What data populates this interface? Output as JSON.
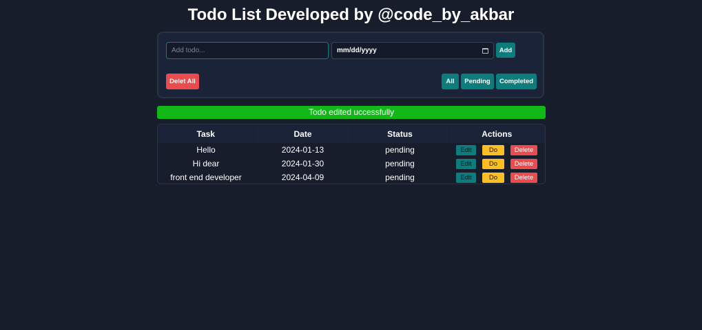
{
  "header": {
    "title": "Todo List Developed by @code_by_akbar"
  },
  "form": {
    "todo_placeholder": "Add todo...",
    "todo_value": "",
    "date_value": "mm/dd/yyyy",
    "date_icon": "calendar-icon",
    "add_label": "Add"
  },
  "controls": {
    "delete_all_label": "Delet All",
    "filters": [
      {
        "label": "All"
      },
      {
        "label": "Pending"
      },
      {
        "label": "Completed"
      }
    ]
  },
  "alert": {
    "text": "Todo edited uccessfully",
    "color": "#12b718"
  },
  "table": {
    "headers": [
      "Task",
      "Date",
      "Status",
      "Actions"
    ],
    "rows": [
      {
        "task": "Hello",
        "date": "2024-01-13",
        "status": "pending"
      },
      {
        "task": "Hi dear",
        "date": "2024-01-30",
        "status": "pending"
      },
      {
        "task": "front end developer",
        "date": "2024-04-09",
        "status": "pending"
      }
    ],
    "actions": {
      "edit_label": "Edit",
      "do_label": "Do",
      "delete_label": "Delete"
    }
  },
  "colors": {
    "background": "#181d2c",
    "card": "#1a2338",
    "teal": "#0d7c7c",
    "red": "#e94b4f",
    "yellow": "#fbbf24",
    "green": "#12b718"
  }
}
